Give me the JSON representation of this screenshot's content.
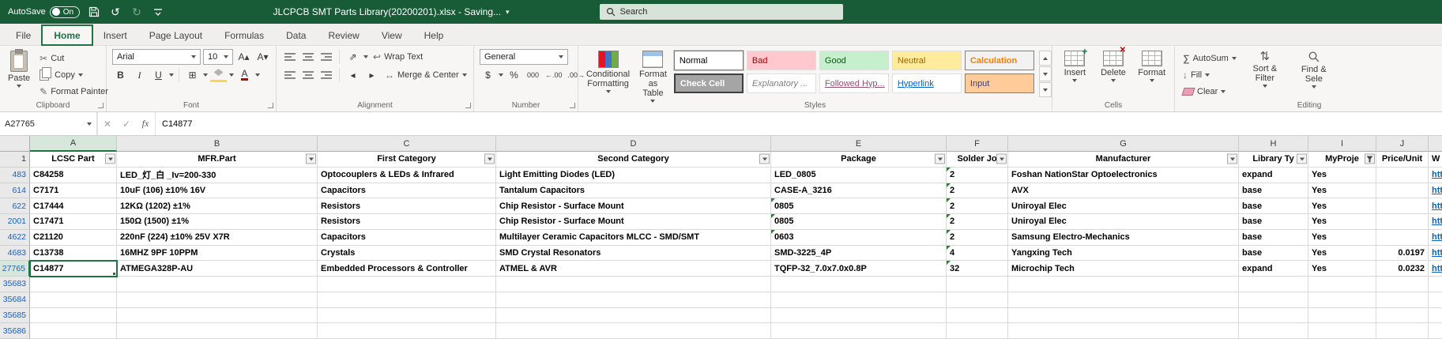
{
  "icons": {
    "chevron_down": "▾",
    "undo": "↺",
    "redo": "↻",
    "cut": "✂",
    "format_painter": "✎",
    "bold": "B",
    "italic": "I",
    "underline": "U",
    "borders": "⊞",
    "orientation": "⇗",
    "wrap": "↩",
    "merge": "↔",
    "indent_dec": "◂",
    "indent_inc": "▸",
    "currency": "$",
    "percent": "%",
    "comma": "000",
    "inc_decimal": "←.00",
    "dec_decimal": ".00→",
    "sum": "∑",
    "fill": "↓",
    "sort": "⇅",
    "font_color_letter": "A",
    "grow_font": "A▴",
    "shrink_font": "A▾",
    "check": "✓",
    "cross": "✕"
  },
  "titlebar": {
    "autosave_label": "AutoSave",
    "autosave_state": "On",
    "title": "JLCPCB SMT Parts Library(20200201).xlsx - Saving...",
    "search_placeholder": "Search"
  },
  "tabs": [
    "File",
    "Home",
    "Insert",
    "Page Layout",
    "Formulas",
    "Data",
    "Review",
    "View",
    "Help"
  ],
  "ribbon": {
    "clipboard": {
      "label": "Clipboard",
      "paste": "Paste",
      "cut": "Cut",
      "copy": "Copy",
      "format_painter": "Format Painter"
    },
    "font": {
      "label": "Font",
      "family": "Arial",
      "size": "10"
    },
    "alignment": {
      "label": "Alignment",
      "wrap_text": "Wrap Text",
      "merge_center": "Merge & Center"
    },
    "number": {
      "label": "Number",
      "format": "General"
    },
    "styles": {
      "label": "Styles",
      "conditional": "Conditional Formatting",
      "format_table": "Format as Table",
      "gallery": [
        "Normal",
        "Bad",
        "Good",
        "Neutral",
        "Calculation",
        "Check Cell",
        "Explanatory ...",
        "Followed Hyp...",
        "Hyperlink",
        "Input"
      ]
    },
    "cells": {
      "label": "Cells",
      "insert": "Insert",
      "delete": "Delete",
      "format": "Format"
    },
    "editing": {
      "label": "Editing",
      "autosum": "AutoSum",
      "fill": "Fill",
      "clear": "Clear",
      "sort": "Sort & Filter",
      "find": "Find & Sele"
    }
  },
  "formula_bar": {
    "name_box": "A27765",
    "fx": "fx",
    "value": "C14877"
  },
  "sheet": {
    "header_row": "1",
    "columns": [
      {
        "letter": "A",
        "header": "LCSC Part"
      },
      {
        "letter": "B",
        "header": "MFR.Part"
      },
      {
        "letter": "C",
        "header": "First Category"
      },
      {
        "letter": "D",
        "header": "Second Category"
      },
      {
        "letter": "E",
        "header": "Package"
      },
      {
        "letter": "F",
        "header": "Solder Jo"
      },
      {
        "letter": "G",
        "header": "Manufacturer"
      },
      {
        "letter": "H",
        "header": "Library Ty"
      },
      {
        "letter": "I",
        "header": "MyProje"
      },
      {
        "letter": "J",
        "header": "Price/Unit"
      },
      {
        "letter": "",
        "header": "W"
      }
    ],
    "rows": [
      {
        "n": "483",
        "a": "C84258",
        "b": "LED_灯_白 _Iv=200-330",
        "c": "Optocouplers & LEDs & Infrared",
        "d": "Light Emitting Diodes (LED)",
        "e": "LED_0805",
        "f": "2",
        "g": "Foshan NationStar Optoelectronics",
        "h": "expand",
        "i": "Yes",
        "j": "",
        "k": "htt"
      },
      {
        "n": "614",
        "a": "C7171",
        "b": "10uF (106) ±10% 16V",
        "c": "Capacitors",
        "d": "Tantalum Capacitors",
        "e": "CASE-A_3216",
        "f": "2",
        "g": "AVX",
        "h": "base",
        "i": "Yes",
        "j": "",
        "k": "htt"
      },
      {
        "n": "622",
        "a": "C17444",
        "b": "12KΩ (1202) ±1%",
        "c": "Resistors",
        "d": "Chip Resistor - Surface Mount",
        "e": "0805",
        "f": "2",
        "g": "Uniroyal Elec",
        "h": "base",
        "i": "Yes",
        "j": "",
        "k": "htt"
      },
      {
        "n": "2001",
        "a": "C17471",
        "b": "150Ω (1500) ±1%",
        "c": "Resistors",
        "d": "Chip Resistor - Surface Mount",
        "e": "0805",
        "f": "2",
        "g": "Uniroyal Elec",
        "h": "base",
        "i": "Yes",
        "j": "",
        "k": "htt"
      },
      {
        "n": "4622",
        "a": "C21120",
        "b": "220nF (224) ±10% 25V X7R",
        "c": "Capacitors",
        "d": "Multilayer Ceramic Capacitors MLCC - SMD/SMT",
        "e": "0603",
        "f": "2",
        "g": "Samsung Electro-Mechanics",
        "h": "base",
        "i": "Yes",
        "j": "",
        "k": "htt"
      },
      {
        "n": "4683",
        "a": "C13738",
        "b": "16MHZ 9PF 10PPM",
        "c": "Crystals",
        "d": "SMD Crystal Resonators",
        "e": "SMD-3225_4P",
        "f": "4",
        "g": "Yangxing Tech",
        "h": "base",
        "i": "Yes",
        "j": "0.0197",
        "k": "htt"
      },
      {
        "n": "27765",
        "a": "C14877",
        "b": "ATMEGA328P-AU",
        "c": "Embedded Processors & Controller",
        "d": "ATMEL & AVR",
        "e": "TQFP-32_7.0x7.0x0.8P",
        "f": "32",
        "g": "Microchip Tech",
        "h": "expand",
        "i": "Yes",
        "j": "0.0232",
        "k": "htt"
      }
    ],
    "tail_rows": [
      "35683",
      "35684",
      "35685",
      "35686"
    ]
  }
}
